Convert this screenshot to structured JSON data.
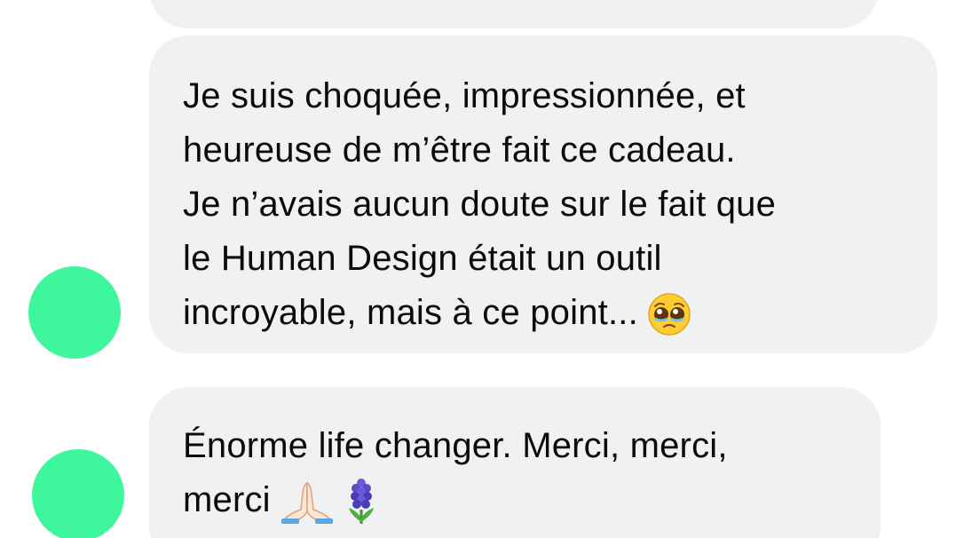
{
  "colors": {
    "avatar": "#3ef79c",
    "bubble": "#f0f1f3",
    "text": "#0b0b0b"
  },
  "messages": [
    {
      "lines": [
        "Je suis choquée, impressionnée, et",
        "heureuse de m’être fait ce cadeau.",
        "Je n’avais aucun doute sur le fait que",
        "le Human Design était un outil",
        "incroyable, mais à ce point..."
      ],
      "emoji": [
        "pleading-face-icon"
      ]
    },
    {
      "lines": [
        "Énorme life changer. Merci, merci,",
        "merci"
      ],
      "emoji": [
        "folded-hands-icon",
        "hyacinth-icon"
      ]
    }
  ]
}
